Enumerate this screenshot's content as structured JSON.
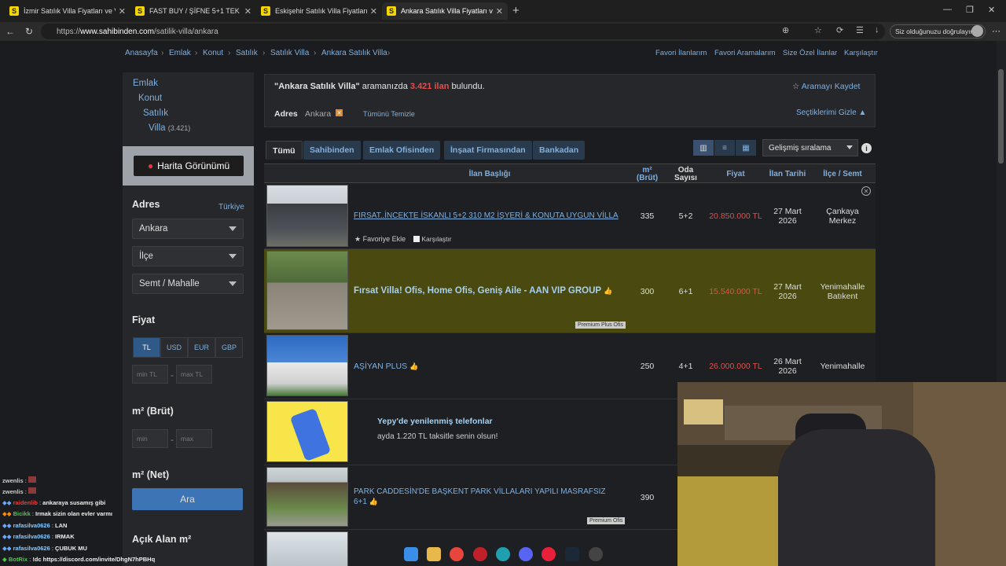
{
  "browser": {
    "tabs": [
      {
        "title": "İzmir Satılık Villa Fiyatları ve Villa İl"
      },
      {
        "title": "FAST BUY / ŞİFNE 5+1 TEK MÜSTAK"
      },
      {
        "title": "Eskişehir Satılık Villa Fiyatları ve V"
      },
      {
        "title": "Ankara Satılık Villa Fiyatları ve Villa"
      }
    ],
    "url_prefix": "https://",
    "url_host": "www.sahibinden.com",
    "url_path": "/satilik-villa/ankara",
    "verify_text": "Siz olduğunuzu doğrulayın"
  },
  "breadcrumb": [
    "Anasayfa",
    "Emlak",
    "Konut",
    "Satılık",
    "Satılık Villa",
    "Ankara Satılık Villa"
  ],
  "top_links": [
    "Favori İlanlarım",
    "Favori Aramalarım",
    "Size Özel İlanlar",
    "Karşılaştır"
  ],
  "sidebar": {
    "categories": {
      "emlak": "Emlak",
      "konut": "Konut",
      "satilik": "Satılık",
      "villa": "Villa",
      "villa_count": "(3.421)"
    },
    "map_button": "Harita Görünümü",
    "address_heading": "Adres",
    "address_country": "Türkiye",
    "city_value": "Ankara",
    "district_placeholder": "İlçe",
    "neighborhood_placeholder": "Semt / Mahalle",
    "price_heading": "Fiyat",
    "currencies": [
      "TL",
      "USD",
      "EUR",
      "GBP"
    ],
    "min_tl": "min TL",
    "max_tl": "max TL",
    "m2_brut_heading": "m² (Brüt)",
    "min": "min",
    "max": "max",
    "m2_net_heading": "m² (Net)",
    "search_button": "Ara",
    "open_area_heading": "Açık Alan m²"
  },
  "search": {
    "query": "\"Ankara Satılık Villa\"",
    "text_mid": "aramanızda",
    "count": "3.421 ilan",
    "text_end": "bulundu.",
    "save": "Aramayı Kaydet",
    "address_label": "Adres",
    "address_value": "Ankara",
    "clear_all": "Tümünü Temizle",
    "hide_selections": "Seçtiklerimi Gizle"
  },
  "filter_tabs": [
    "Tümü",
    "Sahibinden",
    "Emlak Ofisinden",
    "İnşaat Firmasından",
    "Bankadan"
  ],
  "sort_label": "Gelişmiş sıralama",
  "columns": {
    "title": "İlan Başlığı",
    "m2": "m²\n(Brüt)",
    "rooms": "Oda\nSayısı",
    "price": "Fiyat",
    "date": "İlan Tarihi",
    "location": "İlçe / Semt"
  },
  "listings": [
    {
      "title": "FIRSAT..İNCEKTE İSKANLI 5+2 310 M2 İŞYERİ & KONUTA UYGUN VİLLA",
      "m2": "335",
      "rooms": "5+2",
      "price": "20.850.000 TL",
      "date": "27 Mart 2026",
      "location": "Çankaya Merkez",
      "fav": "Favoriye Ekle",
      "compare": "Karşılaştır"
    },
    {
      "title": "Fırsat Villa! Ofis, Home Ofis, Geniş Aile - AAN VIP GROUP",
      "m2": "300",
      "rooms": "6+1",
      "price": "15.540.000 TL",
      "date": "27 Mart 2026",
      "location": "Yenimahalle Batıkent",
      "badge": "Premium Plus Ofis"
    },
    {
      "title": "AŞİYAN PLUS",
      "m2": "250",
      "rooms": "4+1",
      "price": "26.000.000 TL",
      "date": "26 Mart 2026",
      "location": "Yenimahalle"
    },
    {
      "ad_title": "Yepy'de yenilenmiş telefonlar",
      "ad_sub": "ayda 1.220 TL taksitle senin olsun!"
    },
    {
      "title": "PARK CADDESİN'DE BAŞKENT PARK VİLLALARI YAPILI MASRAFSIZ 6+1",
      "m2": "390",
      "badge": "Premium Ofis"
    }
  ],
  "chat": [
    {
      "user": "zwenlis",
      "msg": ""
    },
    {
      "user": "zwenlis",
      "msg": ""
    },
    {
      "user": "raidenlib",
      "msg": "ankaraya susamış gibi"
    },
    {
      "user": "Bicikk",
      "msg": "Irmak sizin olan evler varmı"
    },
    {
      "user": "rafasilva0626",
      "msg": "LAN"
    },
    {
      "user": "rafasilva0626",
      "msg": "IRMAK"
    },
    {
      "user": "rafasilva0626",
      "msg": "ÇUBUK MU"
    },
    {
      "user": "BotRix",
      "msg": "!dc https://discord.com/invite/DhgN7hPBHq"
    }
  ],
  "colors": {
    "link": "#7fb0e0",
    "price": "#e0504a",
    "highlight": "#4a4a10",
    "accent": "#3d74b6"
  }
}
